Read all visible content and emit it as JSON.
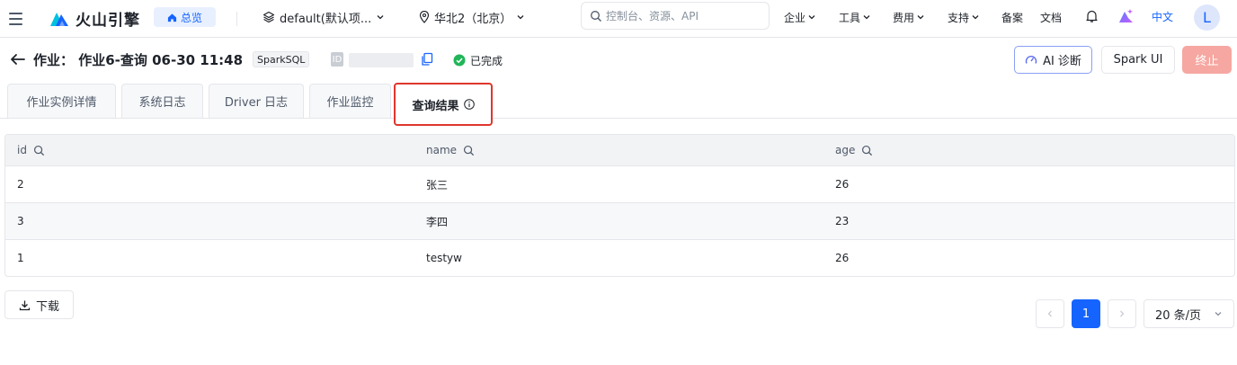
{
  "nav": {
    "logo_text": "火山引擎",
    "overview_label": "总览",
    "project_label": "default(默认项...",
    "region_label": "华北2（北京）",
    "search_placeholder": "控制台、资源、API",
    "links": [
      "企业",
      "工具",
      "费用",
      "支持",
      "备案",
      "文档"
    ],
    "language": "中文",
    "avatar_initial": "L"
  },
  "header": {
    "title": "作业：  作业6-查询 06-30 11:48",
    "type_tag": "SparkSQL",
    "id_label": "ID",
    "status": "已完成",
    "buttons": {
      "ai": "AI 诊断",
      "spark": "Spark UI",
      "stop": "终止"
    }
  },
  "tabs": [
    {
      "label": "作业实例详情"
    },
    {
      "label": "系统日志"
    },
    {
      "label": "Driver 日志"
    },
    {
      "label": "作业监控"
    },
    {
      "label": "查询结果",
      "active": true
    }
  ],
  "table": {
    "columns": [
      "id",
      "name",
      "age"
    ],
    "rows": [
      [
        "2",
        "张三",
        "26"
      ],
      [
        "3",
        "李四",
        "23"
      ],
      [
        "1",
        "testyw",
        "26"
      ]
    ]
  },
  "footer": {
    "download": "下载",
    "current_page": "1",
    "page_size": "20 条/页"
  },
  "colors": {
    "primary": "#1664ff",
    "success": "#21b559",
    "danger_soft": "#f6a7a1",
    "highlight": "#e0362d"
  }
}
